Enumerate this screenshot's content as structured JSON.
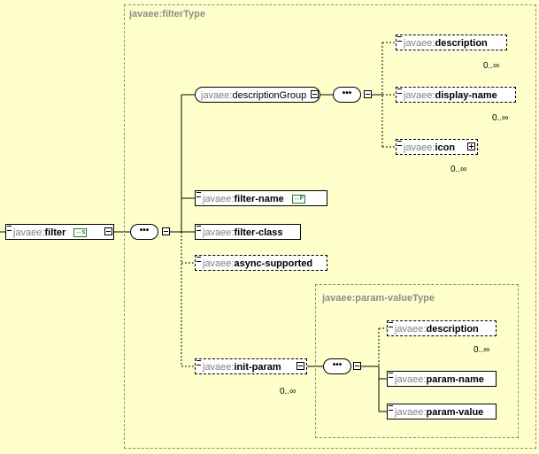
{
  "frames": {
    "filter_type": "javaee:filterType",
    "param_value_type": "javaee:param-valueType"
  },
  "root": {
    "ns": "javaee:",
    "name": "filter",
    "badge": "s"
  },
  "description_group": {
    "ns": "javaee:",
    "name": "descriptionGroup"
  },
  "group_children": [
    {
      "ns": "javaee:",
      "name": "description",
      "card": "0..∞"
    },
    {
      "ns": "javaee:",
      "name": "display-name",
      "card": "0..∞"
    },
    {
      "ns": "javaee:",
      "name": "icon",
      "card": "0..∞"
    }
  ],
  "filter_children": [
    {
      "ns": "javaee:",
      "name": "filter-name",
      "badge": "F"
    },
    {
      "ns": "javaee:",
      "name": "filter-class"
    },
    {
      "ns": "javaee:",
      "name": "async-supported"
    },
    {
      "ns": "javaee:",
      "name": "init-param",
      "card": "0..∞"
    }
  ],
  "param_children": [
    {
      "ns": "javaee:",
      "name": "description",
      "card": "0..∞"
    },
    {
      "ns": "javaee:",
      "name": "param-name"
    },
    {
      "ns": "javaee:",
      "name": "param-value"
    }
  ],
  "sequence_symbol": "•••"
}
